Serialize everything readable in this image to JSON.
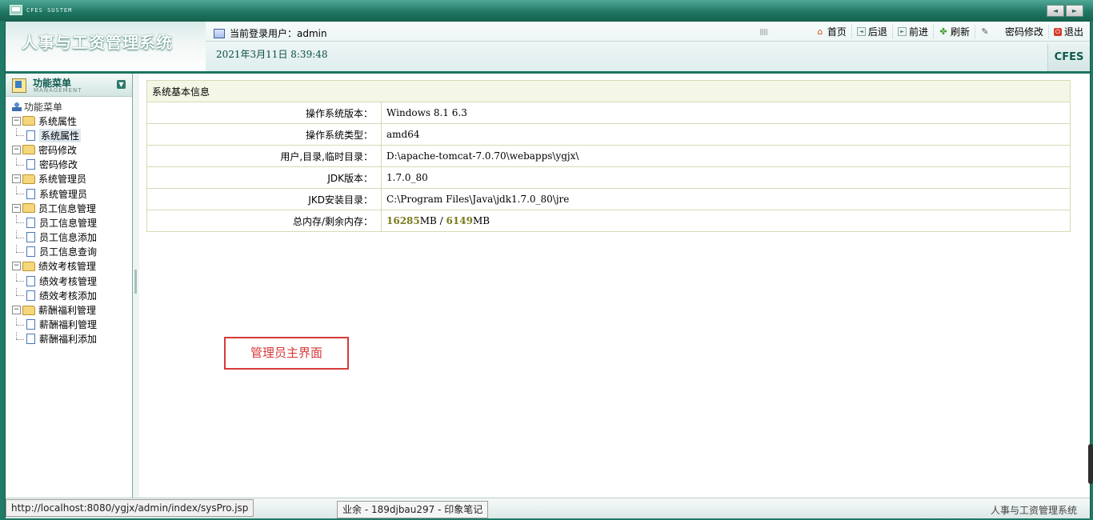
{
  "window": {
    "system_title": "CFES SUSTEM",
    "nav_prev": "◄",
    "nav_next": "►"
  },
  "header": {
    "brand_title": "人事与工资管理系统",
    "user_label": "当前登录用户：admin",
    "datetime": "2021年3月11日 8:39:48",
    "logo": "CFES",
    "toolbar": {
      "home": "首页",
      "back": "后退",
      "forward": "前进",
      "refresh": "刷新",
      "change_password": "密码修改",
      "logout": "退出"
    }
  },
  "sidebar": {
    "title": "功能菜单",
    "subtitle": "MANAGEMENT",
    "root": "功能菜单",
    "groups": [
      {
        "label": "系统属性",
        "items": [
          "系统属性"
        ]
      },
      {
        "label": "密码修改",
        "items": [
          "密码修改"
        ]
      },
      {
        "label": "系统管理员",
        "items": [
          "系统管理员"
        ]
      },
      {
        "label": "员工信息管理",
        "items": [
          "员工信息管理",
          "员工信息添加",
          "员工信息查询"
        ]
      },
      {
        "label": "绩效考核管理",
        "items": [
          "绩效考核管理",
          "绩效考核添加"
        ]
      },
      {
        "label": "薪酬福利管理",
        "items": [
          "薪酬福利管理",
          "薪酬福利添加"
        ]
      }
    ]
  },
  "main": {
    "table_title": "系统基本信息",
    "rows": [
      {
        "label": "操作系统版本：",
        "value": "Windows 8.1  6.3"
      },
      {
        "label": "操作系统类型：",
        "value": "amd64"
      },
      {
        "label": "用户,目录,临时目录：",
        "value": "D:\\apache-tomcat-7.0.70\\webapps\\ygjx\\"
      },
      {
        "label": "JDK版本：",
        "value": "1.7.0_80"
      },
      {
        "label": "JKD安装目录：",
        "value": "C:\\Program Files\\Java\\jdk1.7.0_80\\jre"
      }
    ],
    "memory": {
      "label": "总内存/剩余内存：",
      "total": "16285",
      "free": "6149",
      "unit": "MB",
      "separator": " / "
    },
    "annotation": "管理员主界面"
  },
  "statusbar": {
    "url": "http://localhost:8080/ygjx/admin/index/sysPro.jsp",
    "task": "业余 - 189djbau297 - 印象笔记",
    "app_name": "人事与工资管理系统"
  },
  "colors": {
    "frame": "#1f7a66",
    "accent": "#0e5a4e",
    "annotation": "#d63a3a",
    "memory_number": "#7a7a1a"
  }
}
